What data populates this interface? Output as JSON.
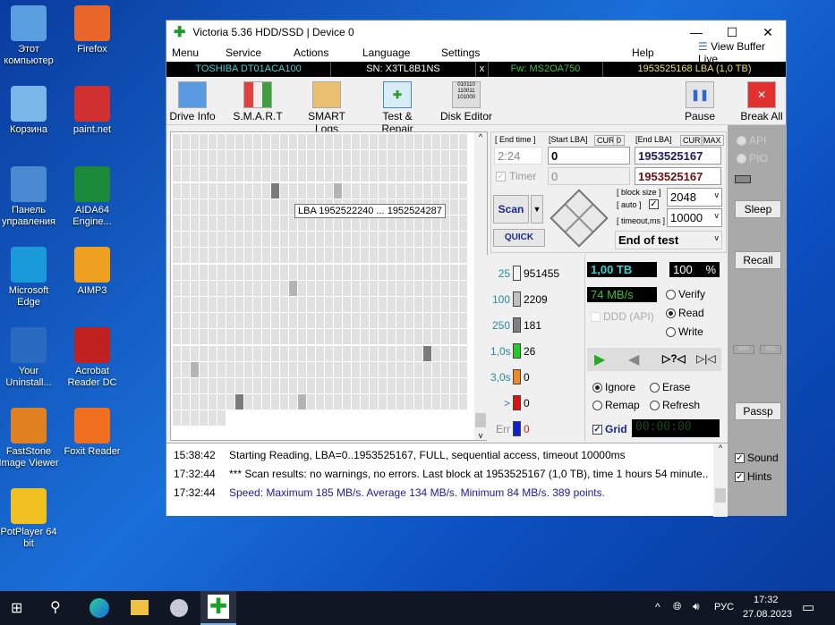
{
  "desktop": {
    "icons": [
      {
        "label": "Этот компьютер",
        "color": "#5aa0e0"
      },
      {
        "label": "Firefox",
        "color": "#e8662a"
      },
      {
        "label": "Корзина",
        "color": "#7ab6e8"
      },
      {
        "label": "paint.net",
        "color": "#d03030"
      },
      {
        "label": "Панель управления",
        "color": "#4a8ad0"
      },
      {
        "label": "AIDA64 Engine...",
        "color": "#1a8a3a"
      },
      {
        "label": "Microsoft Edge",
        "color": "#1a9ad8"
      },
      {
        "label": "AIMP3",
        "color": "#f0a020"
      },
      {
        "label": "Your Uninstall...",
        "color": "#2a6ac0"
      },
      {
        "label": "Acrobat Reader DC",
        "color": "#c02020"
      },
      {
        "label": "FastStone Image Viewer",
        "color": "#e08020"
      },
      {
        "label": "Foxit Reader",
        "color": "#f07020"
      },
      {
        "label": "PotPlayer 64 bit",
        "color": "#f0c020"
      }
    ]
  },
  "window": {
    "title": "Victoria 5.36 HDD/SSD | Device 0",
    "minimize": "—",
    "maximize": "☐",
    "close": "✕"
  },
  "menu": {
    "items": [
      "Menu",
      "Service",
      "Actions",
      "Language",
      "Settings",
      "Help"
    ],
    "view_buffer": "View Buffer Live"
  },
  "info": {
    "model": "TOSHIBA DT01ACA100",
    "serial": "SN: X3TL8B1NS",
    "x": "x",
    "firmware": "Fw: MS2OA750",
    "lba": "1953525168 LBA (1,0 TB)"
  },
  "toolbar": {
    "drive_info": "Drive Info",
    "smart": "S.M.A.R.T",
    "smart_logs": "SMART Logs",
    "test_repair": "Test & Repair",
    "disk_editor": "Disk Editor",
    "pause": "Pause",
    "break_all": "Break All"
  },
  "grid": {
    "tooltip": "LBA  1952522240 ... 1952524287"
  },
  "controls": {
    "end_time_label": "[ End time ]",
    "start_lba_label": "[Start LBA]",
    "cur": "CUR",
    "zero": "0",
    "end_lba_label": "[End LBA]",
    "max": "MAX",
    "end_time": "2:24",
    "start_lba": "0",
    "end_lba": "1953525167",
    "timer_label": "Timer",
    "timer_value": "0",
    "end_lba2": "1953525167",
    "scan": "Scan",
    "quick": "QUICK",
    "block_size_label": "[ block size ]",
    "auto_label": "[ auto ]",
    "timeout_label": "[ timeout,ms ]",
    "block_size": "2048",
    "timeout": "10000",
    "end_action": "End of test"
  },
  "legend": [
    {
      "label": "25",
      "count": "951455",
      "color": "#f4f4f4"
    },
    {
      "label": "100",
      "count": "2209",
      "color": "#c0c0c0"
    },
    {
      "label": "250",
      "count": "181",
      "color": "#808080"
    },
    {
      "label": "1,0s",
      "count": "26",
      "color": "#22cc22"
    },
    {
      "label": "3,0s",
      "count": "0",
      "color": "#f08a20"
    },
    {
      "label": ">",
      "count": "0",
      "color": "#e01010"
    },
    {
      "label": "Err",
      "count": "0",
      "color": "#1020d0"
    }
  ],
  "status": {
    "size": "1,00 TB",
    "percent": "100",
    "percent_sign": "%",
    "speed": "74 MB/s",
    "ddd": "DDD (API)",
    "verify": "Verify",
    "read": "Read",
    "write": "Write",
    "ignore": "Ignore",
    "erase": "Erase",
    "remap": "Remap",
    "refresh": "Refresh",
    "grid": "Grid",
    "timer": "00:00:00"
  },
  "side": {
    "api": "API",
    "pio": "PIO",
    "sleep": "Sleep",
    "recall": "Recall",
    "wr": "WR",
    "rd": "RD",
    "passp": "Passp",
    "sound": "Sound",
    "hints": "Hints"
  },
  "log": [
    {
      "time": "15:38:42",
      "text": "Starting Reading, LBA=0..1953525167, FULL, sequential access, timeout 10000ms",
      "color": "#000"
    },
    {
      "time": "17:32:44",
      "text": "*** Scan results: no warnings, no errors. Last block at 1953525167 (1,0 TB), time 1 hours 54 minute..",
      "color": "#000"
    },
    {
      "time": "17:32:44",
      "text": "Speed: Maximum 185 MB/s. Average 134 MB/s. Minimum 84 MB/s. 389 points.",
      "color": "#1a1aa0"
    }
  ],
  "taskbar": {
    "lang": "РУС",
    "time": "17:32",
    "date": "27.08.2023"
  }
}
